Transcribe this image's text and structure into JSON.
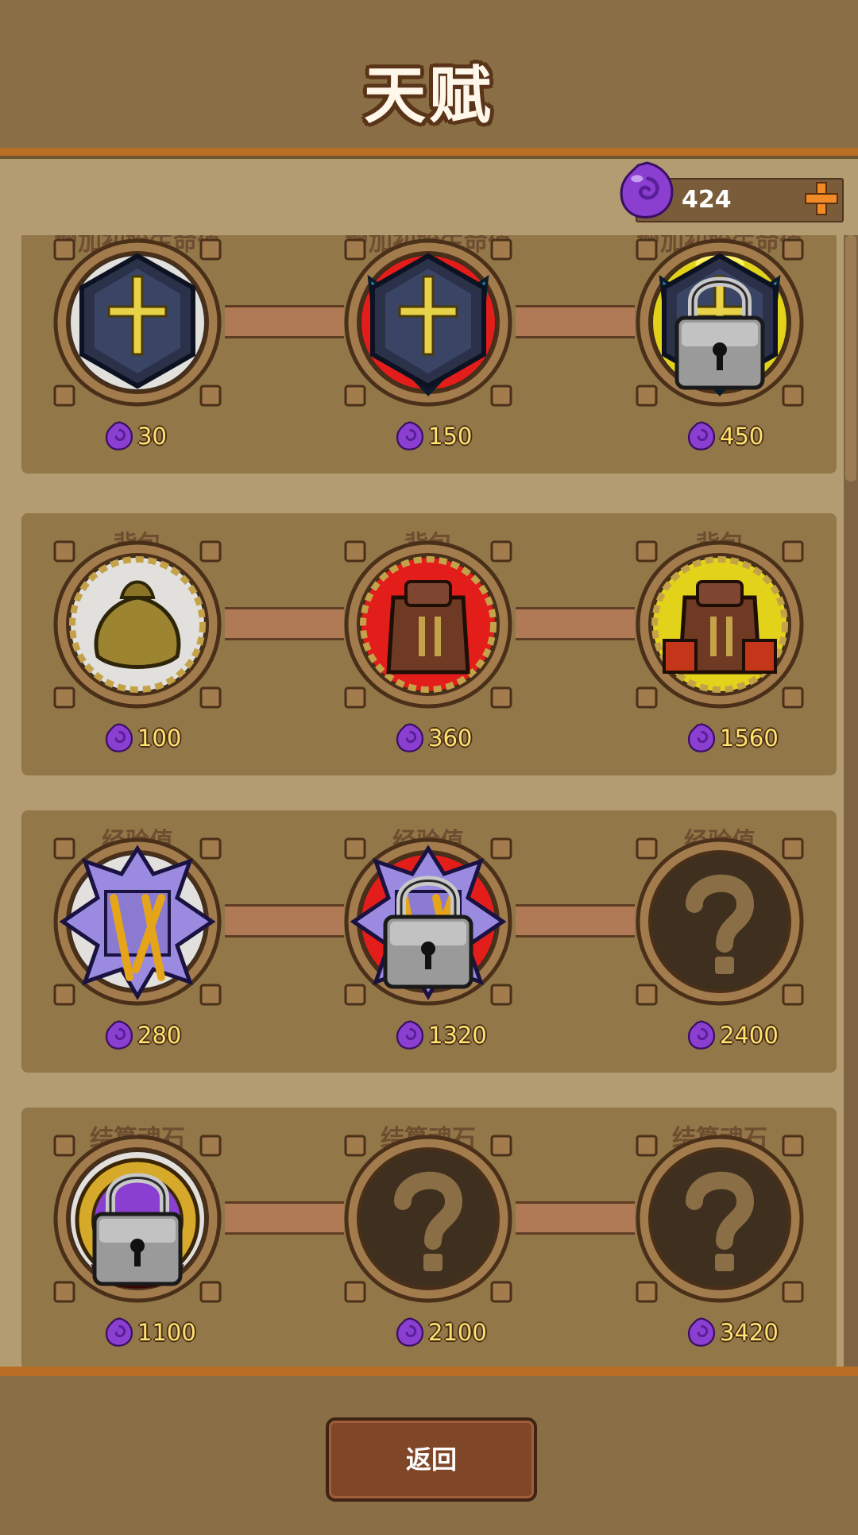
{
  "title": "天赋",
  "currency": {
    "icon": "soul-stone-icon",
    "value": "424"
  },
  "rows": [
    {
      "label": "增加初始生命值",
      "nodes": [
        {
          "icon": "cross-shield-icon",
          "state": "unlocked",
          "glow": "white",
          "cost": "30"
        },
        {
          "icon": "winged-cross-shield-icon",
          "state": "unlocked",
          "glow": "red",
          "cost": "150"
        },
        {
          "icon": "haloed-shield-icon",
          "state": "locked",
          "glow": "yellow",
          "cost": "450"
        }
      ]
    },
    {
      "label": "背包",
      "nodes": [
        {
          "icon": "sack-icon",
          "state": "unlocked",
          "glow": "white",
          "cost": "100"
        },
        {
          "icon": "leather-backpack-icon",
          "state": "unlocked",
          "glow": "red",
          "cost": "360"
        },
        {
          "icon": "armored-backpack-icon",
          "state": "unlocked",
          "glow": "yellow",
          "cost": "1560"
        }
      ]
    },
    {
      "label": "经验值",
      "nodes": [
        {
          "icon": "spiked-tome-icon",
          "state": "unlocked",
          "glow": "white",
          "cost": "280"
        },
        {
          "icon": "spiked-tome-icon",
          "state": "locked",
          "glow": "red",
          "cost": "1320"
        },
        {
          "icon": "question-mark-icon",
          "state": "unknown",
          "glow": "none",
          "cost": "2400"
        }
      ]
    },
    {
      "label": "结算魂石",
      "nodes": [
        {
          "icon": "soul-crown-icon",
          "state": "locked",
          "glow": "white",
          "cost": "1100"
        },
        {
          "icon": "question-mark-icon",
          "state": "unknown",
          "glow": "none",
          "cost": "2100"
        },
        {
          "icon": "question-mark-icon",
          "state": "unknown",
          "glow": "none",
          "cost": "3420"
        }
      ]
    }
  ],
  "back_button": "返回",
  "colors": {
    "accent": "#b86e23",
    "cost_text": "#ffe170",
    "glow_red": "#ff1a1a",
    "glow_yellow": "#ffef1a"
  }
}
